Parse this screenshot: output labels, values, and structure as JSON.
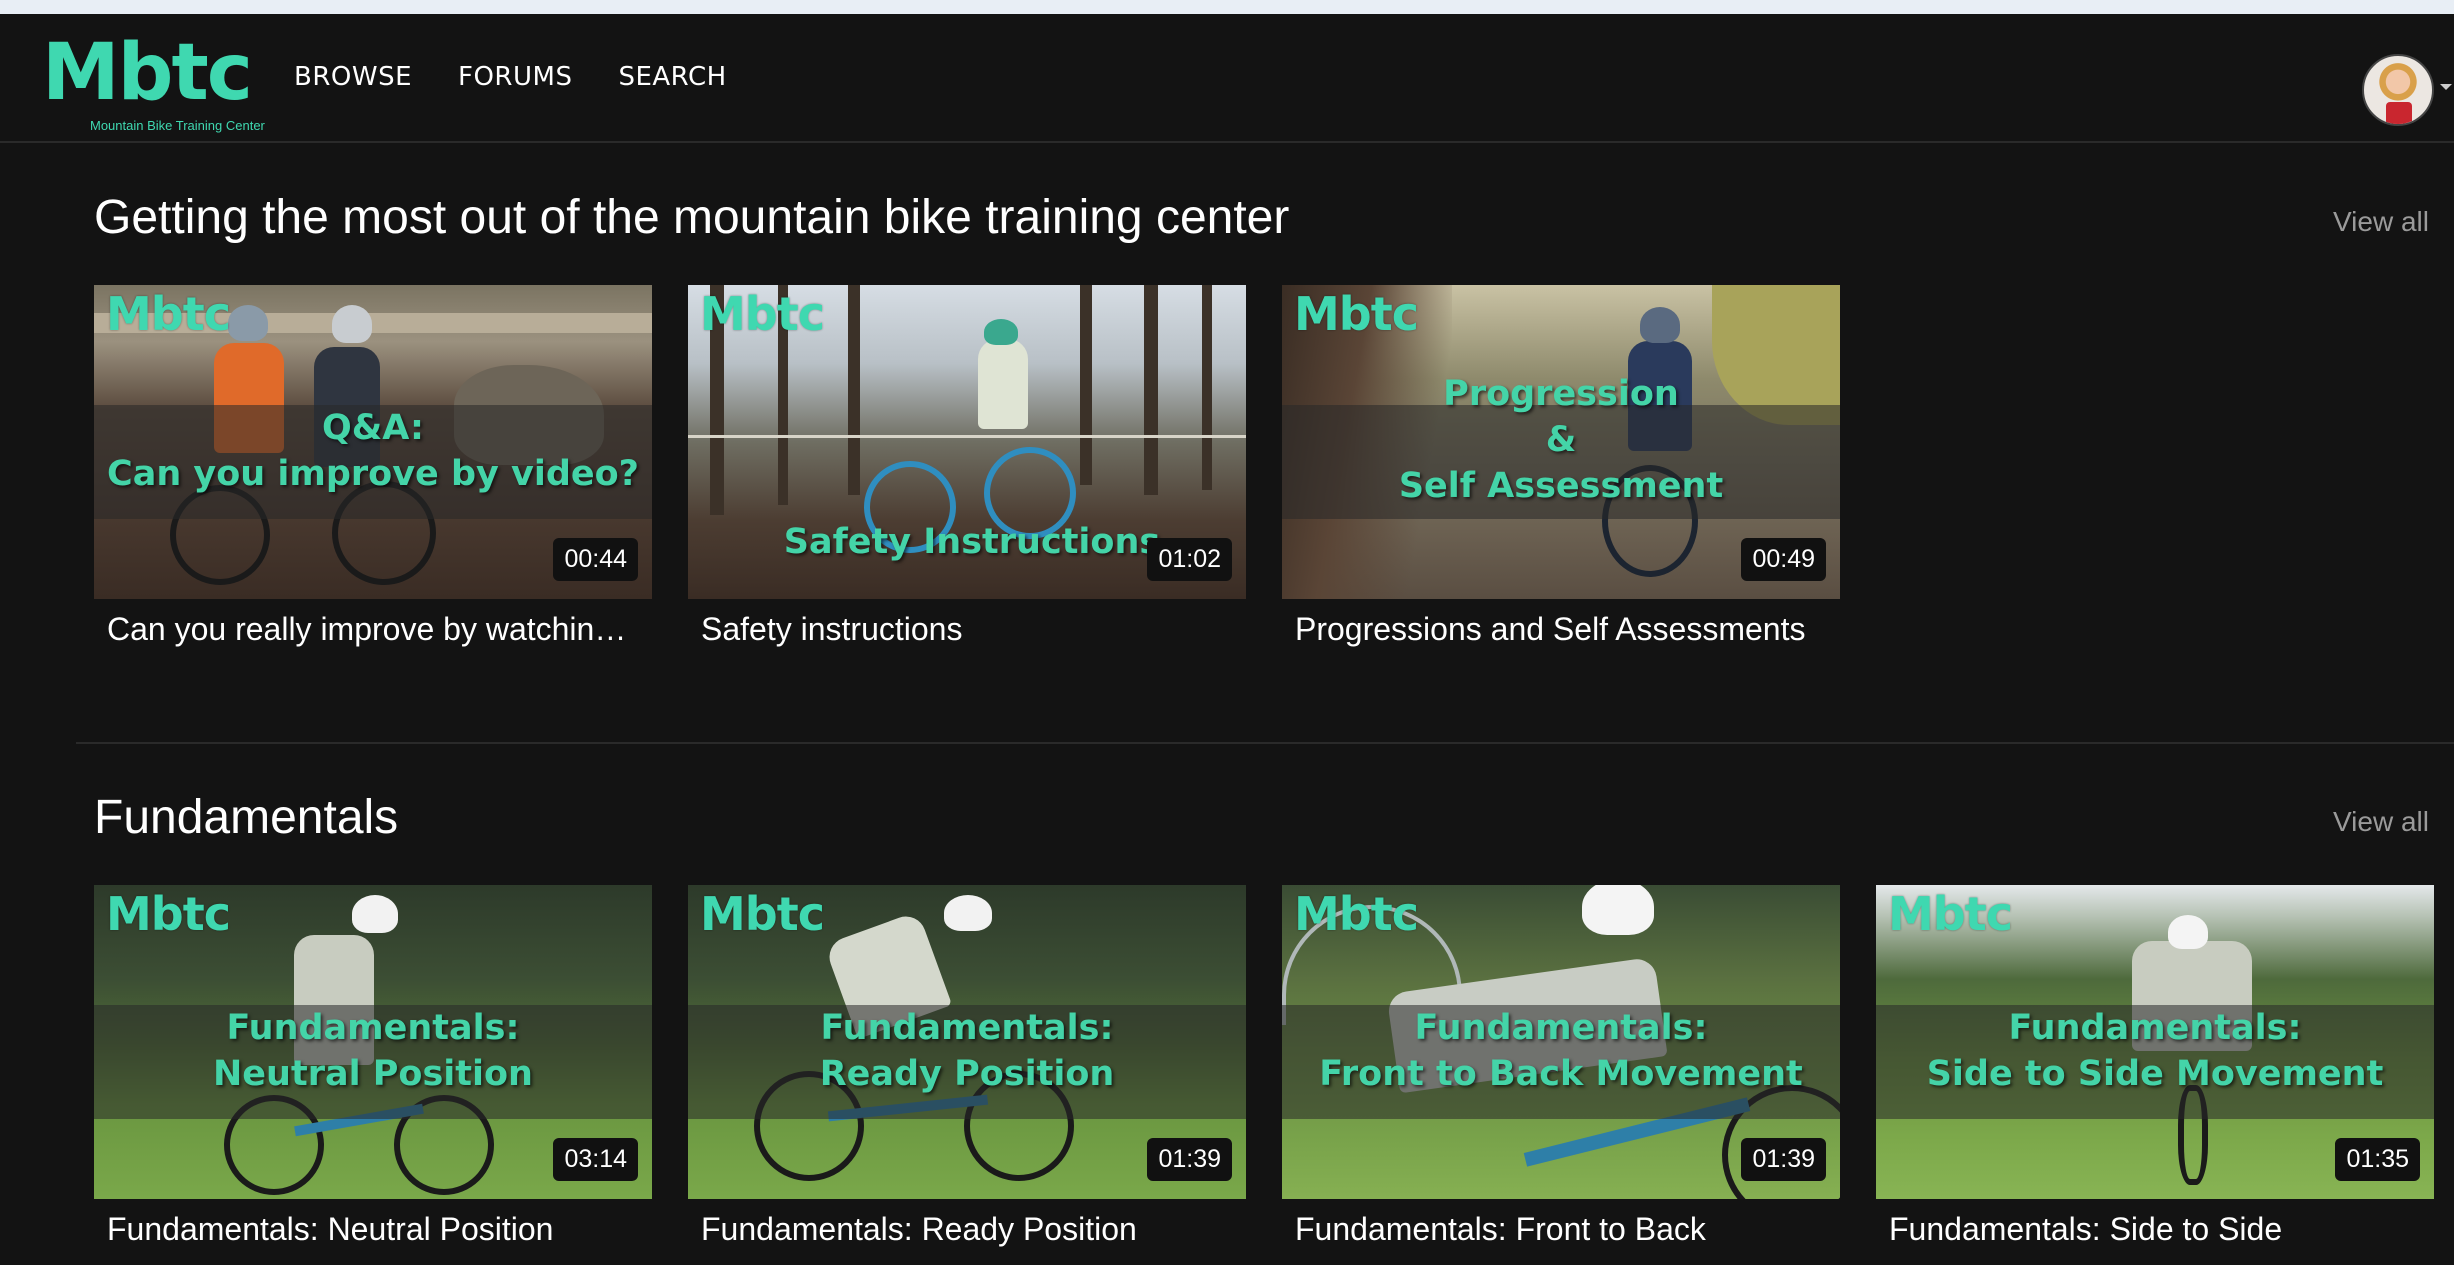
{
  "header": {
    "logo_text": "Mbtc",
    "logo_subtitle": "Mountain Bike Training Center",
    "nav": [
      "BROWSE",
      "FORUMS",
      "SEARCH"
    ]
  },
  "sections": [
    {
      "title": "Getting the most out of the mountain bike training center",
      "view_all_label": "View all",
      "videos": [
        {
          "thumb_logo": "Mbtc",
          "overlay_lines": [
            "Q&A:",
            "Can you improve by video?"
          ],
          "duration": "00:44",
          "title": "Can you really improve by watching videos?"
        },
        {
          "thumb_logo": "Mbtc",
          "overlay_lines": [
            "Safety Instructions"
          ],
          "duration": "01:02",
          "title": "Safety instructions"
        },
        {
          "thumb_logo": "Mbtc",
          "overlay_lines": [
            "Progression",
            "&",
            "Self Assessment"
          ],
          "duration": "00:49",
          "title": "Progressions and Self Assessments"
        }
      ]
    },
    {
      "title": "Fundamentals",
      "view_all_label": "View all",
      "videos": [
        {
          "thumb_logo": "Mbtc",
          "overlay_lines": [
            "Fundamentals:",
            "Neutral Position"
          ],
          "duration": "03:14",
          "title": "Fundamentals: Neutral Position"
        },
        {
          "thumb_logo": "Mbtc",
          "overlay_lines": [
            "Fundamentals:",
            "Ready Position"
          ],
          "duration": "01:39",
          "title": "Fundamentals: Ready Position"
        },
        {
          "thumb_logo": "Mbtc",
          "overlay_lines": [
            "Fundamentals:",
            "Front to Back Movement"
          ],
          "duration": "01:39",
          "title": "Fundamentals: Front to Back"
        },
        {
          "thumb_logo": "Mbtc",
          "overlay_lines": [
            "Fundamentals:",
            "Side to Side Movement"
          ],
          "duration": "01:35",
          "title": "Fundamentals: Side to Side"
        }
      ]
    }
  ],
  "icons": {
    "avatar": "user-avatar-photo",
    "avatar_menu": "chevron-down-icon"
  },
  "colors": {
    "brand_accent": "#3fd8b0",
    "background": "#131313",
    "muted_text": "#9a9a9a"
  }
}
